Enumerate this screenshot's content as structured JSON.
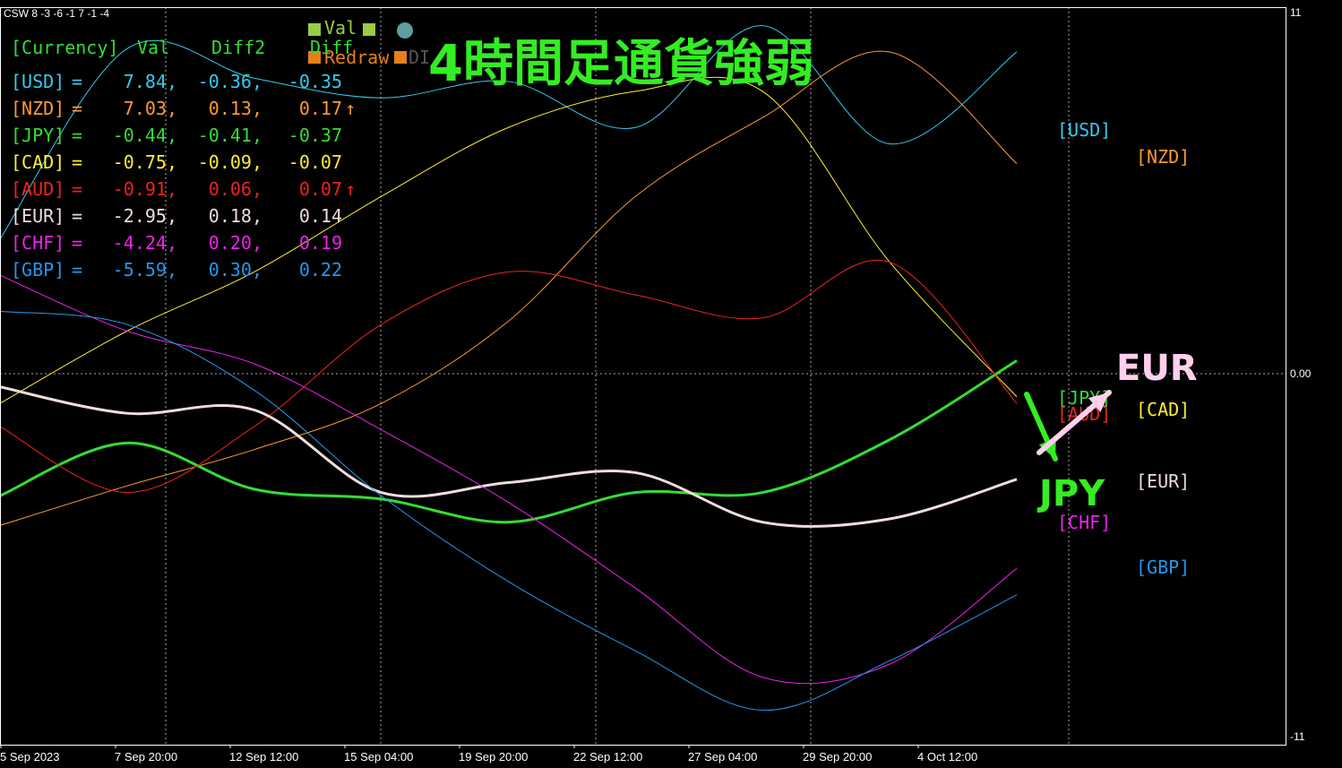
{
  "window": {
    "title": "CSW 8 -3 -6 -1 7 -1 -4",
    "heading": "4時間足通貨強弱",
    "controls": {
      "val": "Val",
      "redraw": "Redraw",
      "diff_btn": "DI",
      "diff_label": "Diff"
    }
  },
  "table": {
    "headers": [
      "[Currency]",
      "Val",
      "Diff2",
      "Diff"
    ],
    "rows": [
      {
        "cur": "[USD]",
        "eq": "=",
        "val": "7.84,",
        "d2": "-0.36,",
        "d": "-0.35",
        "arrow": "",
        "color": "#33ccee"
      },
      {
        "cur": "[NZD]",
        "eq": "=",
        "val": "7.03,",
        "d2": "0.13,",
        "d": "0.17",
        "arrow": "↑",
        "color": "#ff9933"
      },
      {
        "cur": "[JPY]",
        "eq": "=",
        "val": "-0.44,",
        "d2": "-0.41,",
        "d": "-0.37",
        "arrow": "",
        "color": "#33dd33"
      },
      {
        "cur": "[CAD]",
        "eq": "=",
        "val": "-0.75,",
        "d2": "-0.09,",
        "d": "-0.07",
        "arrow": "",
        "color": "#ffee33"
      },
      {
        "cur": "[AUD]",
        "eq": "=",
        "val": "-0.91,",
        "d2": "0.06,",
        "d": "0.07",
        "arrow": "↑",
        "color": "#ee2222"
      },
      {
        "cur": "[EUR]",
        "eq": "=",
        "val": "-2.95,",
        "d2": "0.18,",
        "d": "0.14",
        "arrow": "",
        "color": "#f0dcdc"
      },
      {
        "cur": "[CHF]",
        "eq": "=",
        "val": "-4.24,",
        "d2": "0.20,",
        "d": "0.19",
        "arrow": "",
        "color": "#ee22ee"
      },
      {
        "cur": "[GBP]",
        "eq": "=",
        "val": "-5.59,",
        "d2": "0.30,",
        "d": "0.22",
        "arrow": "",
        "color": "#2299ee"
      }
    ]
  },
  "annotations": {
    "eur": "EUR",
    "jpy": "JPY"
  },
  "chart_data": {
    "type": "line",
    "x": [
      "5 Sep 2023",
      "7 Sep 20:00",
      "12 Sep 12:00",
      "15 Sep 04:00",
      "19 Sep 20:00",
      "22 Sep 12:00",
      "27 Sep 04:00",
      "29 Sep 20:00",
      "4 Oct 12:00"
    ],
    "ylim": [
      -11,
      11
    ],
    "y_ticks": [
      "11",
      "0.00",
      "-11"
    ],
    "grid": true,
    "series": [
      {
        "name": "[USD]",
        "color": "#33ccee",
        "values": [
          4.1,
          9.9,
          9.0,
          8.4,
          8.9,
          7.5,
          10.6,
          7.0,
          9.8
        ]
      },
      {
        "name": "[NZD]",
        "color": "#ff9933",
        "values": [
          -4.6,
          -3.4,
          -2.3,
          -0.9,
          1.6,
          5.4,
          7.8,
          9.8,
          6.4
        ]
      },
      {
        "name": "[JPY]",
        "color": "#33dd33",
        "values": [
          -3.7,
          -2.1,
          -3.5,
          -3.8,
          -4.5,
          -3.6,
          -3.6,
          -2.0,
          0.4
        ]
      },
      {
        "name": "[CAD]",
        "color": "#ffee33",
        "values": [
          -0.9,
          1.3,
          3.1,
          5.4,
          7.5,
          8.6,
          8.6,
          3.4,
          -0.7
        ]
      },
      {
        "name": "[AUD]",
        "color": "#ee2222",
        "values": [
          -1.6,
          -3.6,
          -1.6,
          1.5,
          3.1,
          2.4,
          1.7,
          3.4,
          -0.9
        ]
      },
      {
        "name": "[EUR]",
        "color": "#f0dcdc",
        "values": [
          -0.4,
          -1.2,
          -1.1,
          -3.6,
          -3.3,
          -3.0,
          -4.5,
          -4.4,
          -3.2
        ]
      },
      {
        "name": "[CHF]",
        "color": "#ee22ee",
        "values": [
          3.0,
          1.3,
          0.3,
          -1.7,
          -3.9,
          -6.5,
          -9.2,
          -8.8,
          -5.9
        ]
      },
      {
        "name": "[GBP]",
        "color": "#2299ee",
        "values": [
          1.9,
          1.5,
          -0.5,
          -3.7,
          -6.3,
          -8.4,
          -10.2,
          -8.7,
          -6.7
        ]
      }
    ],
    "right_labels": [
      "[USD]",
      "[NZD]",
      "[JPY]",
      "[AUD]",
      "[CAD]",
      "[EUR]",
      "[CHF]",
      "[GBP]"
    ]
  }
}
